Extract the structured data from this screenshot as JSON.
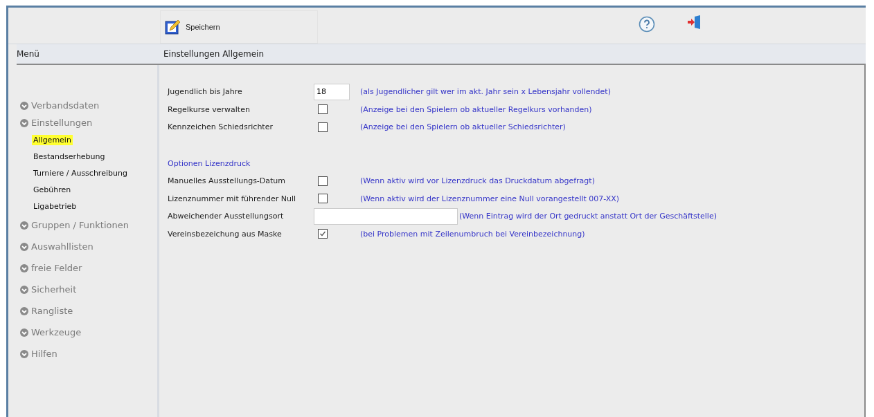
{
  "toolbar": {
    "save_label": "Speichern"
  },
  "header": {
    "menu_title": "Menü",
    "page_title": "Einstellungen Allgemein"
  },
  "sidebar": {
    "items": [
      {
        "label": "Verbandsdaten"
      },
      {
        "label": "Einstellungen",
        "children": [
          {
            "label": "Allgemein",
            "selected": true
          },
          {
            "label": "Bestandserhebung",
            "selected": false
          },
          {
            "label": "Turniere / Ausschreibung",
            "selected": false
          },
          {
            "label": "Gebühren",
            "selected": false
          },
          {
            "label": "Ligabetrieb",
            "selected": false
          }
        ]
      },
      {
        "label": "Gruppen / Funktionen"
      },
      {
        "label": "Auswahllisten"
      },
      {
        "label": "freie Felder"
      },
      {
        "label": "Sicherheit"
      },
      {
        "label": "Rangliste"
      },
      {
        "label": "Werkzeuge"
      },
      {
        "label": "Hilfen"
      }
    ]
  },
  "settings": [
    {
      "kind": "number",
      "label": "Jugendlich bis Jahre",
      "value": "18",
      "hint": "(als Jugendlicher gilt wer im akt. Jahr sein x Lebensjahr vollendet)"
    },
    {
      "kind": "checkbox",
      "label": "Regelkurse verwalten",
      "checked": false,
      "hint": "(Anzeige bei den Spielern ob aktueller Regelkurs vorhanden)"
    },
    {
      "kind": "checkbox",
      "label": "Kennzeichen Schiedsrichter",
      "checked": false,
      "hint": "(Anzeige bei den Spielern ob aktueller Schiedsrichter)"
    },
    {
      "kind": "section",
      "label": "Optionen Lizenzdruck"
    },
    {
      "kind": "checkbox",
      "label": "Manuelles Ausstellungs-Datum",
      "checked": false,
      "hint": "(Wenn aktiv wird vor Lizenzdruck das Druckdatum abgefragt)"
    },
    {
      "kind": "checkbox",
      "label": "Lizenznummer mit führender Null",
      "checked": false,
      "hint": "(Wenn aktiv wird der Lizenznummer eine Null vorangestellt 007-XX)"
    },
    {
      "kind": "text",
      "label": "Abweichender Ausstellungsort",
      "hint": "(Wenn Eintrag wird der Ort gedruckt anstatt Ort der Geschäftstelle)"
    },
    {
      "kind": "checkbox",
      "label": "Vereinsbezeichung aus Maske",
      "checked": true,
      "hint": "(bei Problemen mit Zeilenumbruch bei Vereinbezeichnung)"
    }
  ]
}
